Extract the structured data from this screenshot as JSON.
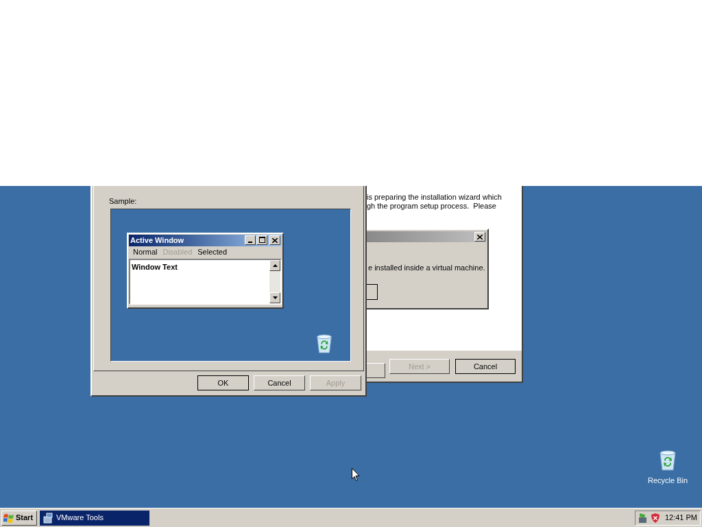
{
  "display_properties": {
    "sample_label": "Sample:",
    "preview_window": {
      "title": "Active Window",
      "menu": [
        {
          "label": "Normal",
          "disabled": false
        },
        {
          "label": "Disabled",
          "disabled": true
        },
        {
          "label": "Selected",
          "disabled": false
        }
      ],
      "window_text": "Window Text"
    },
    "buttons": [
      {
        "label": "OK",
        "default": true,
        "disabled": false
      },
      {
        "label": "Cancel",
        "default": false,
        "disabled": false
      },
      {
        "label": "Apply",
        "default": false,
        "disabled": true
      }
    ]
  },
  "installer": {
    "text_lines": [
      "is preparing the installation wizard which",
      "gh the program setup process.  Please"
    ],
    "buttons": [
      {
        "label": "Next >",
        "default": false,
        "disabled": true
      },
      {
        "label": "Cancel",
        "default": true,
        "disabled": false
      }
    ]
  },
  "message_box": {
    "message": "e installed inside a virtual machine."
  },
  "desktop_icons": [
    {
      "label": "Recycle Bin"
    }
  ],
  "taskbar": {
    "start": "Start",
    "tasks": [
      {
        "label": "VMware Tools",
        "selected": true
      }
    ],
    "clock": "12:41 PM"
  }
}
